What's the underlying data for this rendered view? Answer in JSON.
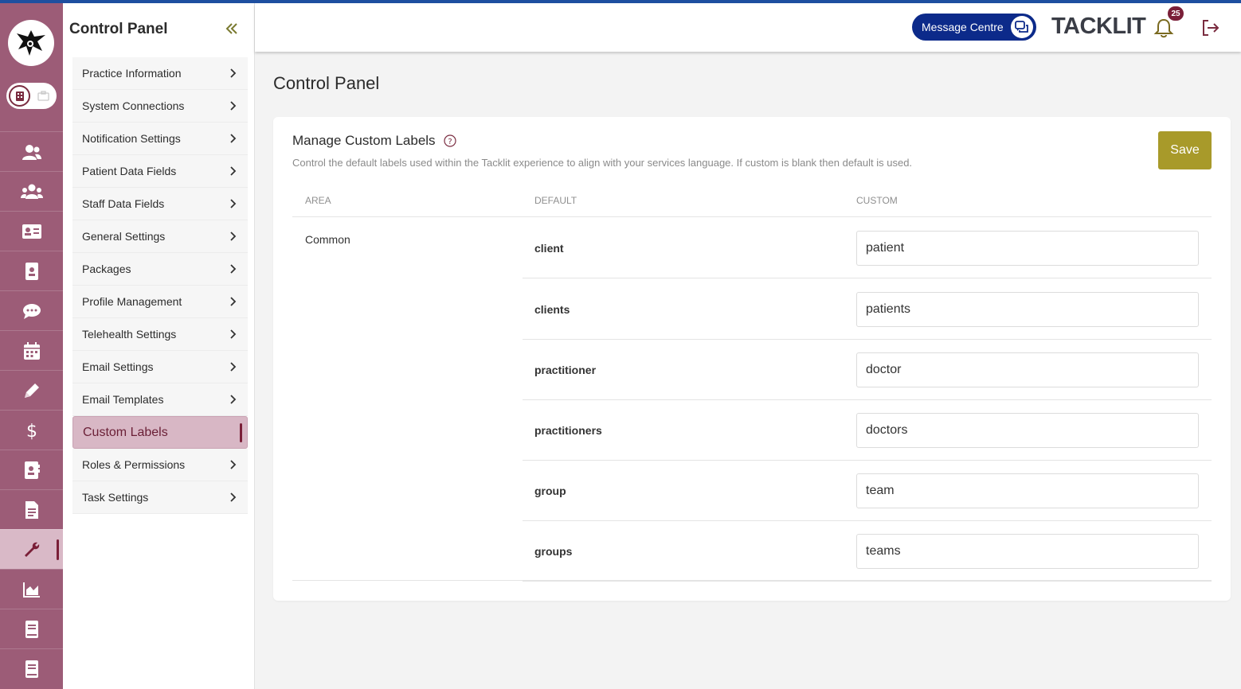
{
  "colors": {
    "accent": "#7a1f38",
    "rail": "#9c5c77",
    "save": "#a89a2a",
    "message_btn": "#0c2a8a",
    "topline": "#1e4fa0"
  },
  "rail": {
    "items": [
      {
        "icon": "user-icon"
      },
      {
        "icon": "users-group-icon"
      },
      {
        "icon": "id-card-icon"
      },
      {
        "icon": "id-badge-icon"
      },
      {
        "icon": "chat-icon"
      },
      {
        "icon": "calendar-icon"
      },
      {
        "icon": "pen-icon"
      },
      {
        "icon": "dollar-icon"
      },
      {
        "icon": "contact-book-icon"
      },
      {
        "icon": "file-invoice-icon"
      },
      {
        "icon": "wrench-icon",
        "active": true
      },
      {
        "icon": "chart-area-icon"
      },
      {
        "icon": "book-icon"
      },
      {
        "icon": "book-icon"
      }
    ]
  },
  "subnav": {
    "title": "Control Panel",
    "items": [
      {
        "label": "Practice Information"
      },
      {
        "label": "System Connections"
      },
      {
        "label": "Notification Settings"
      },
      {
        "label": "Patient Data Fields"
      },
      {
        "label": "Staff Data Fields"
      },
      {
        "label": "General Settings"
      },
      {
        "label": "Packages"
      },
      {
        "label": "Profile Management"
      },
      {
        "label": "Telehealth Settings"
      },
      {
        "label": "Email Settings"
      },
      {
        "label": "Email Templates"
      },
      {
        "label": "Custom Labels",
        "active": true
      },
      {
        "label": "Roles & Permissions"
      },
      {
        "label": "Task Settings"
      }
    ]
  },
  "header": {
    "message_centre_label": "Message Centre",
    "brand": "TACKLIT",
    "notification_count": "25"
  },
  "main": {
    "page_title": "Control Panel",
    "card_title": "Manage Custom Labels",
    "card_description": "Control the default labels used within the Tacklit experience to align with your services language. If custom is blank then default is used.",
    "save_label": "Save",
    "columns": {
      "area": "AREA",
      "default": "DEFAULT",
      "custom": "CUSTOM"
    },
    "area": "Common",
    "rows": [
      {
        "default": "client",
        "custom": "patient"
      },
      {
        "default": "clients",
        "custom": "patients"
      },
      {
        "default": "practitioner",
        "custom": "doctor"
      },
      {
        "default": "practitioners",
        "custom": "doctors"
      },
      {
        "default": "group",
        "custom": "team"
      },
      {
        "default": "groups",
        "custom": "teams"
      }
    ]
  }
}
